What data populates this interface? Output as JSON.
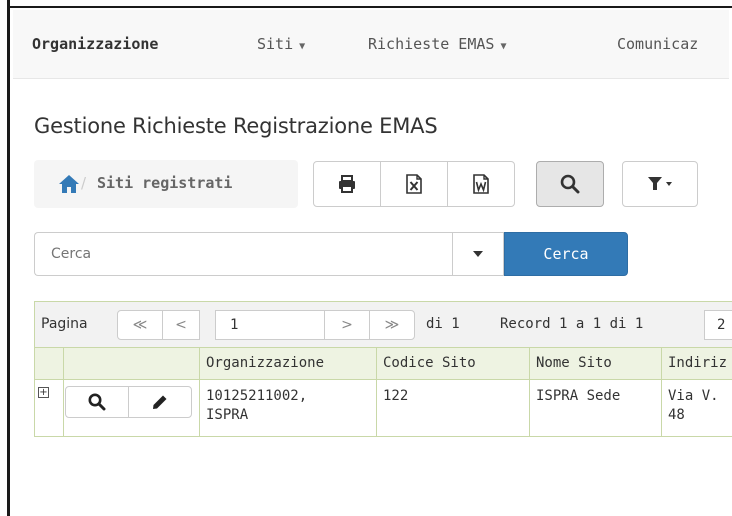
{
  "navbar": {
    "brand": "Organizzazione",
    "items": [
      {
        "label": "Siti"
      },
      {
        "label": "Richieste EMAS"
      },
      {
        "label": "Comunicaz"
      }
    ]
  },
  "page": {
    "title": "Gestione Richieste Registrazione EMAS"
  },
  "breadcrumb": {
    "current": "Siti registrati"
  },
  "toolbar": {
    "icons": [
      "print-icon",
      "excel-icon",
      "word-icon",
      "search-icon",
      "filter-icon"
    ]
  },
  "search": {
    "placeholder": "Cerca",
    "button_label": "Cerca"
  },
  "pager": {
    "label": "Pagina",
    "current_page": "1",
    "of_pages": "di 1",
    "records": "Record 1 a 1 di 1",
    "page_size": "2"
  },
  "table": {
    "columns": [
      "Organizzazione",
      "Codice Sito",
      "Nome Sito",
      "Indiriz"
    ],
    "rows": [
      {
        "organizzazione_line1": "10125211002,",
        "organizzazione_line2": "ISPRA",
        "codice_sito": "122",
        "nome_sito": "ISPRA Sede",
        "indirizzo_line1": "Via V.",
        "indirizzo_line2": "48"
      }
    ]
  },
  "colors": {
    "primary": "#337ab7",
    "grid_header": "#eef3e2",
    "grid_border": "#c9d8a8",
    "navbar_bg": "#f8f8f8"
  }
}
